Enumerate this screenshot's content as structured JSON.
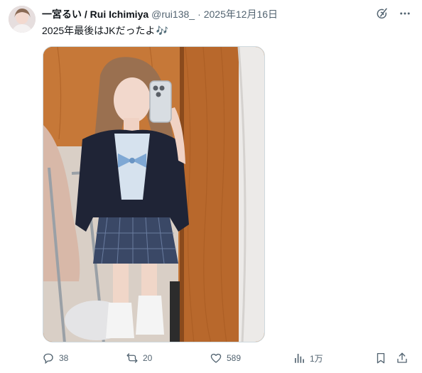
{
  "author": {
    "display_name": "一宮るい / Rui Ichimiya",
    "handle": "@rui138_",
    "separator": "·",
    "date": "2025年12月16日"
  },
  "tweet": {
    "text": "2025年最後はJKだったよ",
    "emoji": "🎶"
  },
  "header_icons": [
    "grok-icon",
    "more-icon"
  ],
  "actions": {
    "replies": "38",
    "retweets": "20",
    "likes": "589",
    "views": "1万"
  },
  "colors": {
    "text": "#0f1419",
    "muted": "#536471",
    "border": "#cfd9de"
  }
}
